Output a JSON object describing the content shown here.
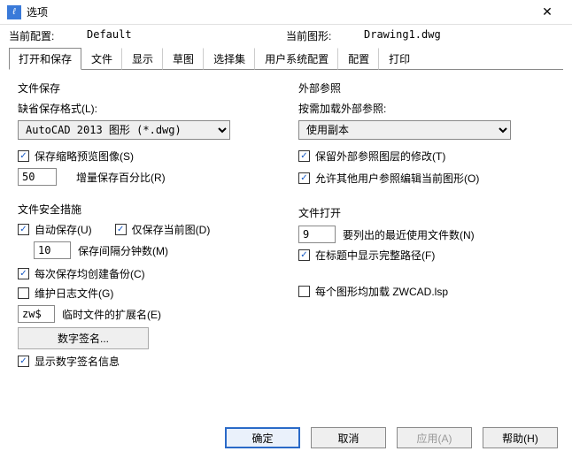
{
  "titlebar": {
    "title": "选项"
  },
  "profile": {
    "current_config_label": "当前配置:",
    "current_config_value": "Default",
    "current_drawing_label": "当前图形:",
    "current_drawing_value": "Drawing1.dwg"
  },
  "tabs": [
    "打开和保存",
    "文件",
    "显示",
    "草图",
    "选择集",
    "用户系统配置",
    "配置",
    "打印"
  ],
  "active_tab_index": 0,
  "file_save": {
    "group_title": "文件保存",
    "default_format_label": "缺省保存格式(L):",
    "default_format_value": "AutoCAD 2013 图形 (*.dwg)",
    "save_thumbnail_label": "保存缩略预览图像(S)",
    "save_thumbnail_checked": true,
    "incremental_percent_value": "50",
    "incremental_percent_label": "增量保存百分比(R)"
  },
  "safety": {
    "group_title": "文件安全措施",
    "autosave_label": "自动保存(U)",
    "autosave_checked": true,
    "current_only_label": "仅保存当前图(D)",
    "current_only_checked": true,
    "interval_value": "10",
    "interval_label": "保存间隔分钟数(M)",
    "backup_label": "每次保存均创建备份(C)",
    "backup_checked": true,
    "log_label": "维护日志文件(G)",
    "log_checked": false,
    "temp_ext_value": "zw$",
    "temp_ext_label": "临时文件的扩展名(E)",
    "digital_sig_button": "数字签名...",
    "show_digital_sig_label": "显示数字签名信息",
    "show_digital_sig_checked": true
  },
  "xref": {
    "group_title": "外部参照",
    "load_label": "按需加载外部参照:",
    "load_value": "使用副本",
    "keep_layer_label": "保留外部参照图层的修改(T)",
    "keep_layer_checked": true,
    "allow_edit_label": "允许其他用户参照编辑当前图形(O)",
    "allow_edit_checked": true
  },
  "file_open": {
    "group_title": "文件打开",
    "recent_count_value": "9",
    "recent_count_label": "要列出的最近使用文件数(N)",
    "full_path_label": "在标题中显示完整路径(F)",
    "full_path_checked": true
  },
  "lsp": {
    "load_lsp_label": "每个图形均加载 ZWCAD.lsp",
    "load_lsp_checked": false
  },
  "footer": {
    "ok": "确定",
    "cancel": "取消",
    "apply": "应用(A)",
    "help": "帮助(H)"
  }
}
